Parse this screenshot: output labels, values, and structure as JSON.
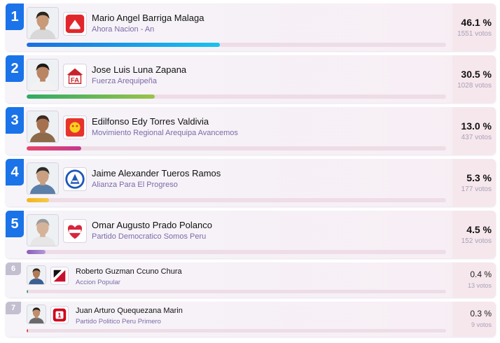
{
  "candidates": [
    {
      "rank": "1",
      "name": "Mario Angel Barriga Malaga",
      "party": "Ahora Nacion - An",
      "percent": "46.1 %",
      "votes": "1551 votos",
      "share": 0.461,
      "bar_colors": [
        "#1a6fe0",
        "#19c2ee"
      ],
      "photo_icon": "man-portrait-icon",
      "logo_icon": "ahora-nacion-logo-icon",
      "logo_color": "#e1262b"
    },
    {
      "rank": "2",
      "name": "Jose Luis Luna Zapana",
      "party": "Fuerza Arequipeña",
      "percent": "30.5 %",
      "votes": "1028 votos",
      "share": 0.305,
      "bar_colors": [
        "#2eab64",
        "#9ac34a"
      ],
      "photo_icon": "man-portrait-icon",
      "logo_icon": "fuerza-arequipena-logo-icon",
      "logo_color": "#c8232c"
    },
    {
      "rank": "3",
      "name": "Edilfonso Edy Torres Valdivia",
      "party": "Movimiento Regional Arequipa Avancemos",
      "percent": "13.0 %",
      "votes": "437 votos",
      "share": 0.13,
      "bar_colors": [
        "#e8456a",
        "#c43a8e"
      ],
      "photo_icon": "man-portrait-icon",
      "logo_icon": "avancemos-logo-icon",
      "logo_color": "#e8322c"
    },
    {
      "rank": "4",
      "name": "Jaime Alexander Tueros Ramos",
      "party": "Alianza Para El Progreso",
      "percent": "5.3 %",
      "votes": "177 votos",
      "share": 0.053,
      "bar_colors": [
        "#f4b41a",
        "#f2c94c"
      ],
      "photo_icon": "man-portrait-icon",
      "logo_icon": "app-logo-icon",
      "logo_color": "#1f57b8"
    },
    {
      "rank": "5",
      "name": "Omar Augusto Prado Polanco",
      "party": "Partido Democratico Somos Peru",
      "percent": "4.5 %",
      "votes": "152 votos",
      "share": 0.045,
      "bar_colors": [
        "#8a5db8",
        "#b39ad6"
      ],
      "photo_icon": "man-portrait-icon",
      "logo_icon": "somos-peru-logo-icon",
      "logo_color": "#d7263d"
    },
    {
      "rank": "6",
      "name": "Roberto Guzman Ccuno Chura",
      "party": "Accion Popular",
      "percent": "0.4 %",
      "votes": "13 votos",
      "share": 0.004,
      "bar_colors": [
        "#3aa55d",
        "#3aa55d"
      ],
      "photo_icon": "man-portrait-icon",
      "logo_icon": "accion-popular-logo-icon",
      "logo_color": "#c8102e"
    },
    {
      "rank": "7",
      "name": "Juan Arturo Quequezana Marin",
      "party": "Partido Politico Peru Primero",
      "percent": "0.3 %",
      "votes": "9 votos",
      "share": 0.003,
      "bar_colors": [
        "#e04040",
        "#e04040"
      ],
      "photo_icon": "man-portrait-icon",
      "logo_icon": "peru-primero-logo-icon",
      "logo_color": "#d0021b"
    }
  ]
}
